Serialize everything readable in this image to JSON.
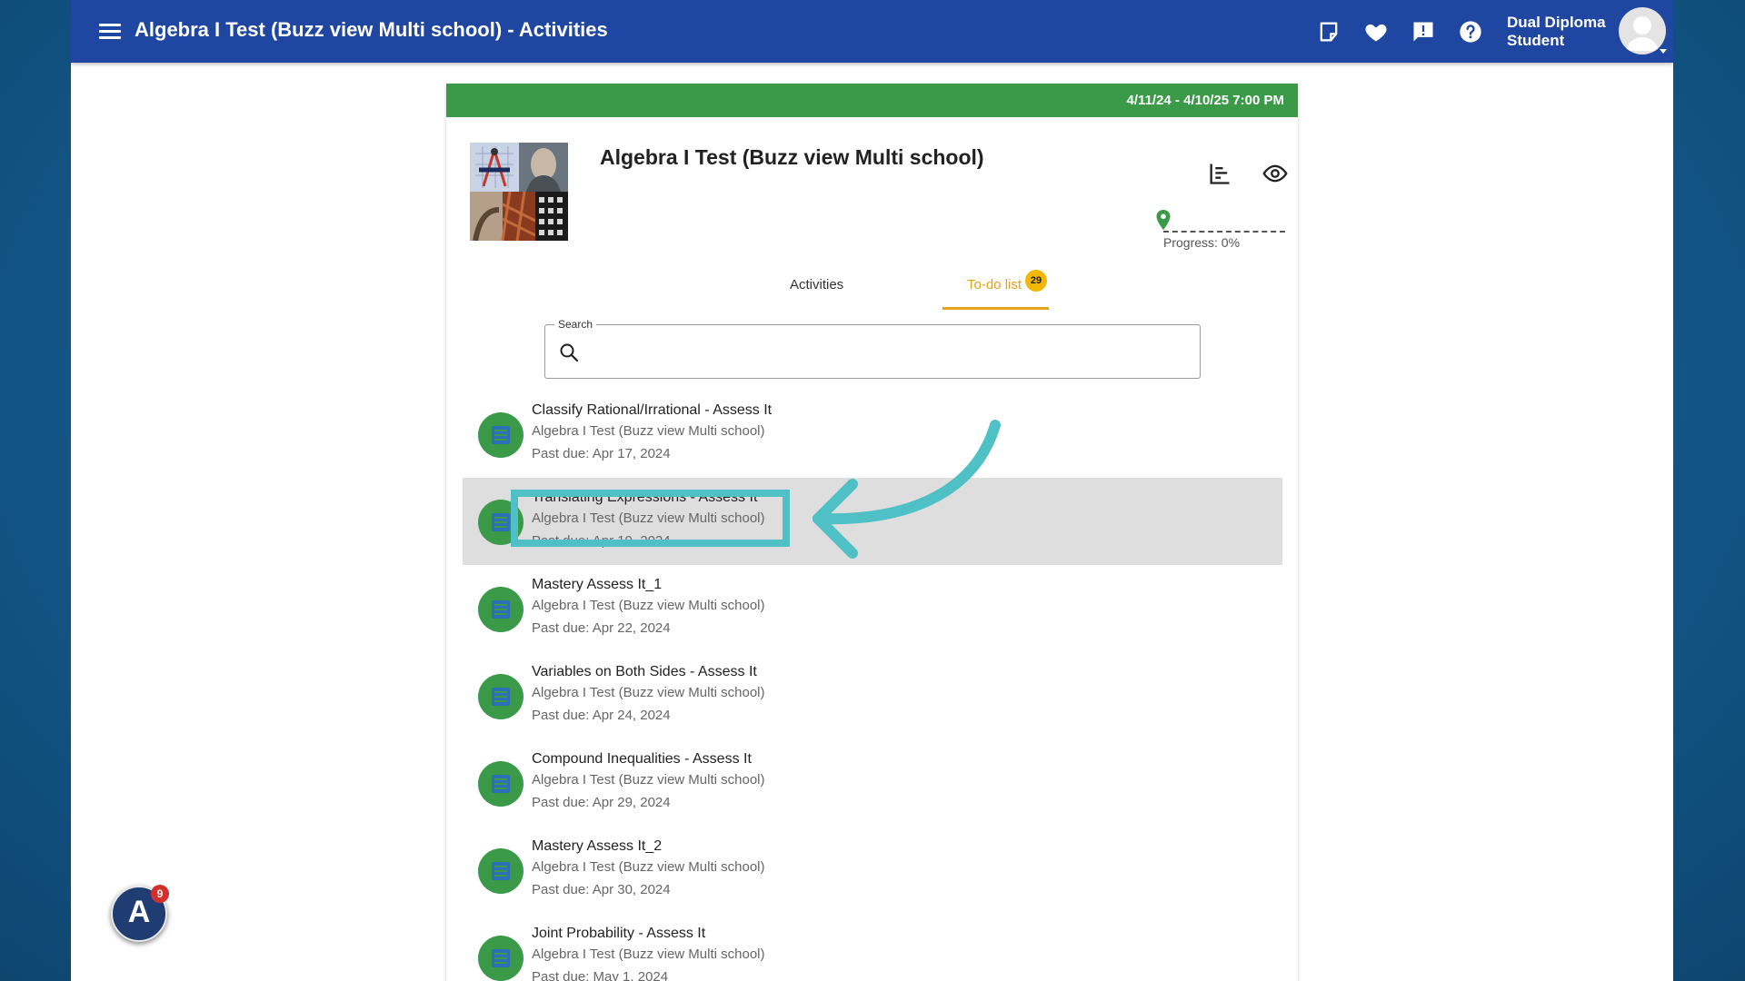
{
  "header": {
    "title": "Algebra I Test (Buzz view Multi school) - Activities",
    "user_name_line1": "Dual Diploma",
    "user_name_line2": "Student",
    "icons": [
      "notes-icon",
      "heart-icon",
      "feedback-icon",
      "help-icon"
    ]
  },
  "course": {
    "date_range": "4/11/24 - 4/10/25 7:00 PM",
    "title": "Algebra I Test (Buzz view Multi school)",
    "progress_label": "Progress: 0%",
    "progress_value": 0
  },
  "tabs": [
    {
      "label": "Activities",
      "active": false
    },
    {
      "label": "To-do list",
      "active": true,
      "badge": "29"
    }
  ],
  "search": {
    "label": "Search",
    "value": "",
    "placeholder": ""
  },
  "todo_items": [
    {
      "title": "Classify Rational/Irrational - Assess It",
      "course": "Algebra I Test (Buzz view Multi school)",
      "due": "Past due: Apr 17, 2024"
    },
    {
      "title": "Translating Expressions - Assess It",
      "course": "Algebra I Test (Buzz view Multi school)",
      "due": "Past due: Apr 19, 2024"
    },
    {
      "title": "Mastery Assess It_1",
      "course": "Algebra I Test (Buzz view Multi school)",
      "due": "Past due: Apr 22, 2024"
    },
    {
      "title": "Variables on Both Sides - Assess It",
      "course": "Algebra I Test (Buzz view Multi school)",
      "due": "Past due: Apr 24, 2024"
    },
    {
      "title": "Compound Inequalities - Assess It",
      "course": "Algebra I Test (Buzz view Multi school)",
      "due": "Past due: Apr 29, 2024"
    },
    {
      "title": "Mastery Assess It_2",
      "course": "Algebra I Test (Buzz view Multi school)",
      "due": "Past due: Apr 30, 2024"
    },
    {
      "title": "Joint Probability - Assess It",
      "course": "Algebra I Test (Buzz view Multi school)",
      "due": "Past due: May 1, 2024"
    }
  ],
  "launcher": {
    "letter": "A",
    "badge": "9"
  },
  "colors": {
    "header": "#1f46a0",
    "date_bar": "#3a9a47",
    "tab_active": "#e6a21a",
    "badge": "#f2b705",
    "annotation": "#4fc0c6"
  }
}
